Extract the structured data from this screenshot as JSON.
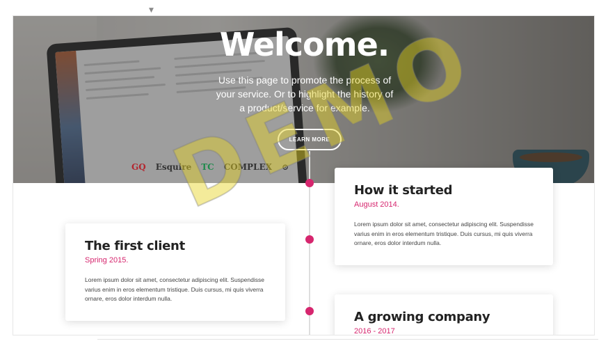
{
  "hero": {
    "title": "Welcome.",
    "text": "Use this page to promote the process of your service. Or to highlight the history of a product/service for example.",
    "button": "LEARN MORE",
    "logos": [
      "GQ",
      "Esquire",
      "TC",
      "COMPLEX",
      "⊙"
    ]
  },
  "timeline": {
    "items": [
      {
        "title": "How it started",
        "date": "August 2014.",
        "body": "Lorem ipsum dolor sit amet, consectetur adipiscing elit. Suspendisse varius enim in eros elementum tristique. Duis cursus, mi quis viverra ornare, eros dolor interdum nulla."
      },
      {
        "title": "The first client",
        "date": "Spring 2015.",
        "body": "Lorem ipsum dolor sit amet, consectetur adipiscing elit. Suspendisse varius enim in eros elementum tristique. Duis cursus, mi quis viverra ornare, eros dolor interdum nulla."
      },
      {
        "title": "A growing company",
        "date": "2016 - 2017",
        "body": ""
      }
    ]
  },
  "watermark": "DEMO",
  "colors": {
    "accent": "#d6266e",
    "watermark": "#e6d21e"
  }
}
